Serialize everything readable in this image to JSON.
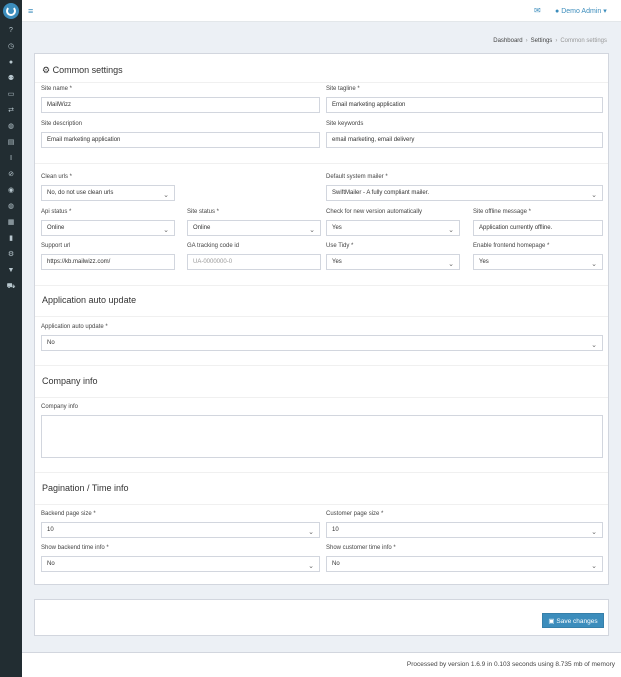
{
  "header": {
    "user_label": "Demo Admin",
    "user_icon": "user-icon",
    "mail_icon": "envelope-icon",
    "menu_icon": "hamburger-icon"
  },
  "sidebar": {
    "items": [
      {
        "icon": "help-icon"
      },
      {
        "icon": "clock-icon"
      },
      {
        "icon": "user-icon"
      },
      {
        "icon": "users-icon"
      },
      {
        "icon": "card-icon"
      },
      {
        "icon": "exchange-icon"
      },
      {
        "icon": "globe-icon"
      },
      {
        "icon": "list-icon"
      },
      {
        "icon": "text-icon"
      },
      {
        "icon": "ban-icon"
      },
      {
        "icon": "circle-icon"
      },
      {
        "icon": "globe2-icon"
      },
      {
        "icon": "server-icon"
      },
      {
        "icon": "file-icon"
      },
      {
        "icon": "gear-icon"
      },
      {
        "icon": "bookmark-icon"
      },
      {
        "icon": "cart-icon"
      }
    ]
  },
  "breadcrumb": {
    "items": [
      "Dashboard",
      "Settings",
      "Common settings"
    ]
  },
  "panel": {
    "title": "Common settings",
    "title_icon": "gear-icon"
  },
  "fields": {
    "site_name": {
      "label": "Site name *",
      "value": "MailWizz"
    },
    "site_tagline": {
      "label": "Site tagline *",
      "value": "Email marketing application"
    },
    "site_description": {
      "label": "Site description",
      "value": "Email marketing application"
    },
    "site_keywords": {
      "label": "Site keywords",
      "value": "email marketing, email delivery"
    },
    "clean_urls": {
      "label": "Clean urls *",
      "value": "No, do not use clean urls"
    },
    "default_mailer": {
      "label": "Default system mailer *",
      "value": "SwiftMailer - A fully compliant mailer."
    },
    "api_status": {
      "label": "Api status *",
      "value": "Online"
    },
    "site_status": {
      "label": "Site status *",
      "value": "Online"
    },
    "check_version": {
      "label": "Check for new version automatically",
      "value": "Yes"
    },
    "offline_message": {
      "label": "Site offline message *",
      "value": "Application currently offline."
    },
    "support_url": {
      "label": "Support url",
      "value": "https://kb.mailwizz.com/"
    },
    "ga_tracking": {
      "label": "GA tracking code id",
      "placeholder": "UA-0000000-0"
    },
    "use_tidy": {
      "label": "Use Tidy *",
      "value": "Yes"
    },
    "frontend_homepage": {
      "label": "Enable frontend homepage *",
      "value": "Yes"
    }
  },
  "auto_update": {
    "title": "Application auto update",
    "label": "Application auto update *",
    "value": "No"
  },
  "company": {
    "title": "Company info",
    "label": "Company info"
  },
  "pagination": {
    "title": "Pagination / Time info",
    "backend_page_size": {
      "label": "Backend page size *",
      "value": "10"
    },
    "customer_page_size": {
      "label": "Customer page size *",
      "value": "10"
    },
    "backend_time_info": {
      "label": "Show backend time info *",
      "value": "No"
    },
    "customer_time_info": {
      "label": "Show customer time info *",
      "value": "No"
    }
  },
  "actions": {
    "save_label": "Save changes",
    "save_icon": "save-icon"
  },
  "footer": {
    "text": "Processed by version 1.6.9 in 0.103 seconds using 8.735 mb of memory"
  },
  "colors": {
    "accent": "#3c8dbc",
    "sidebar_bg": "#222d32",
    "page_bg": "#ecf0f5"
  }
}
